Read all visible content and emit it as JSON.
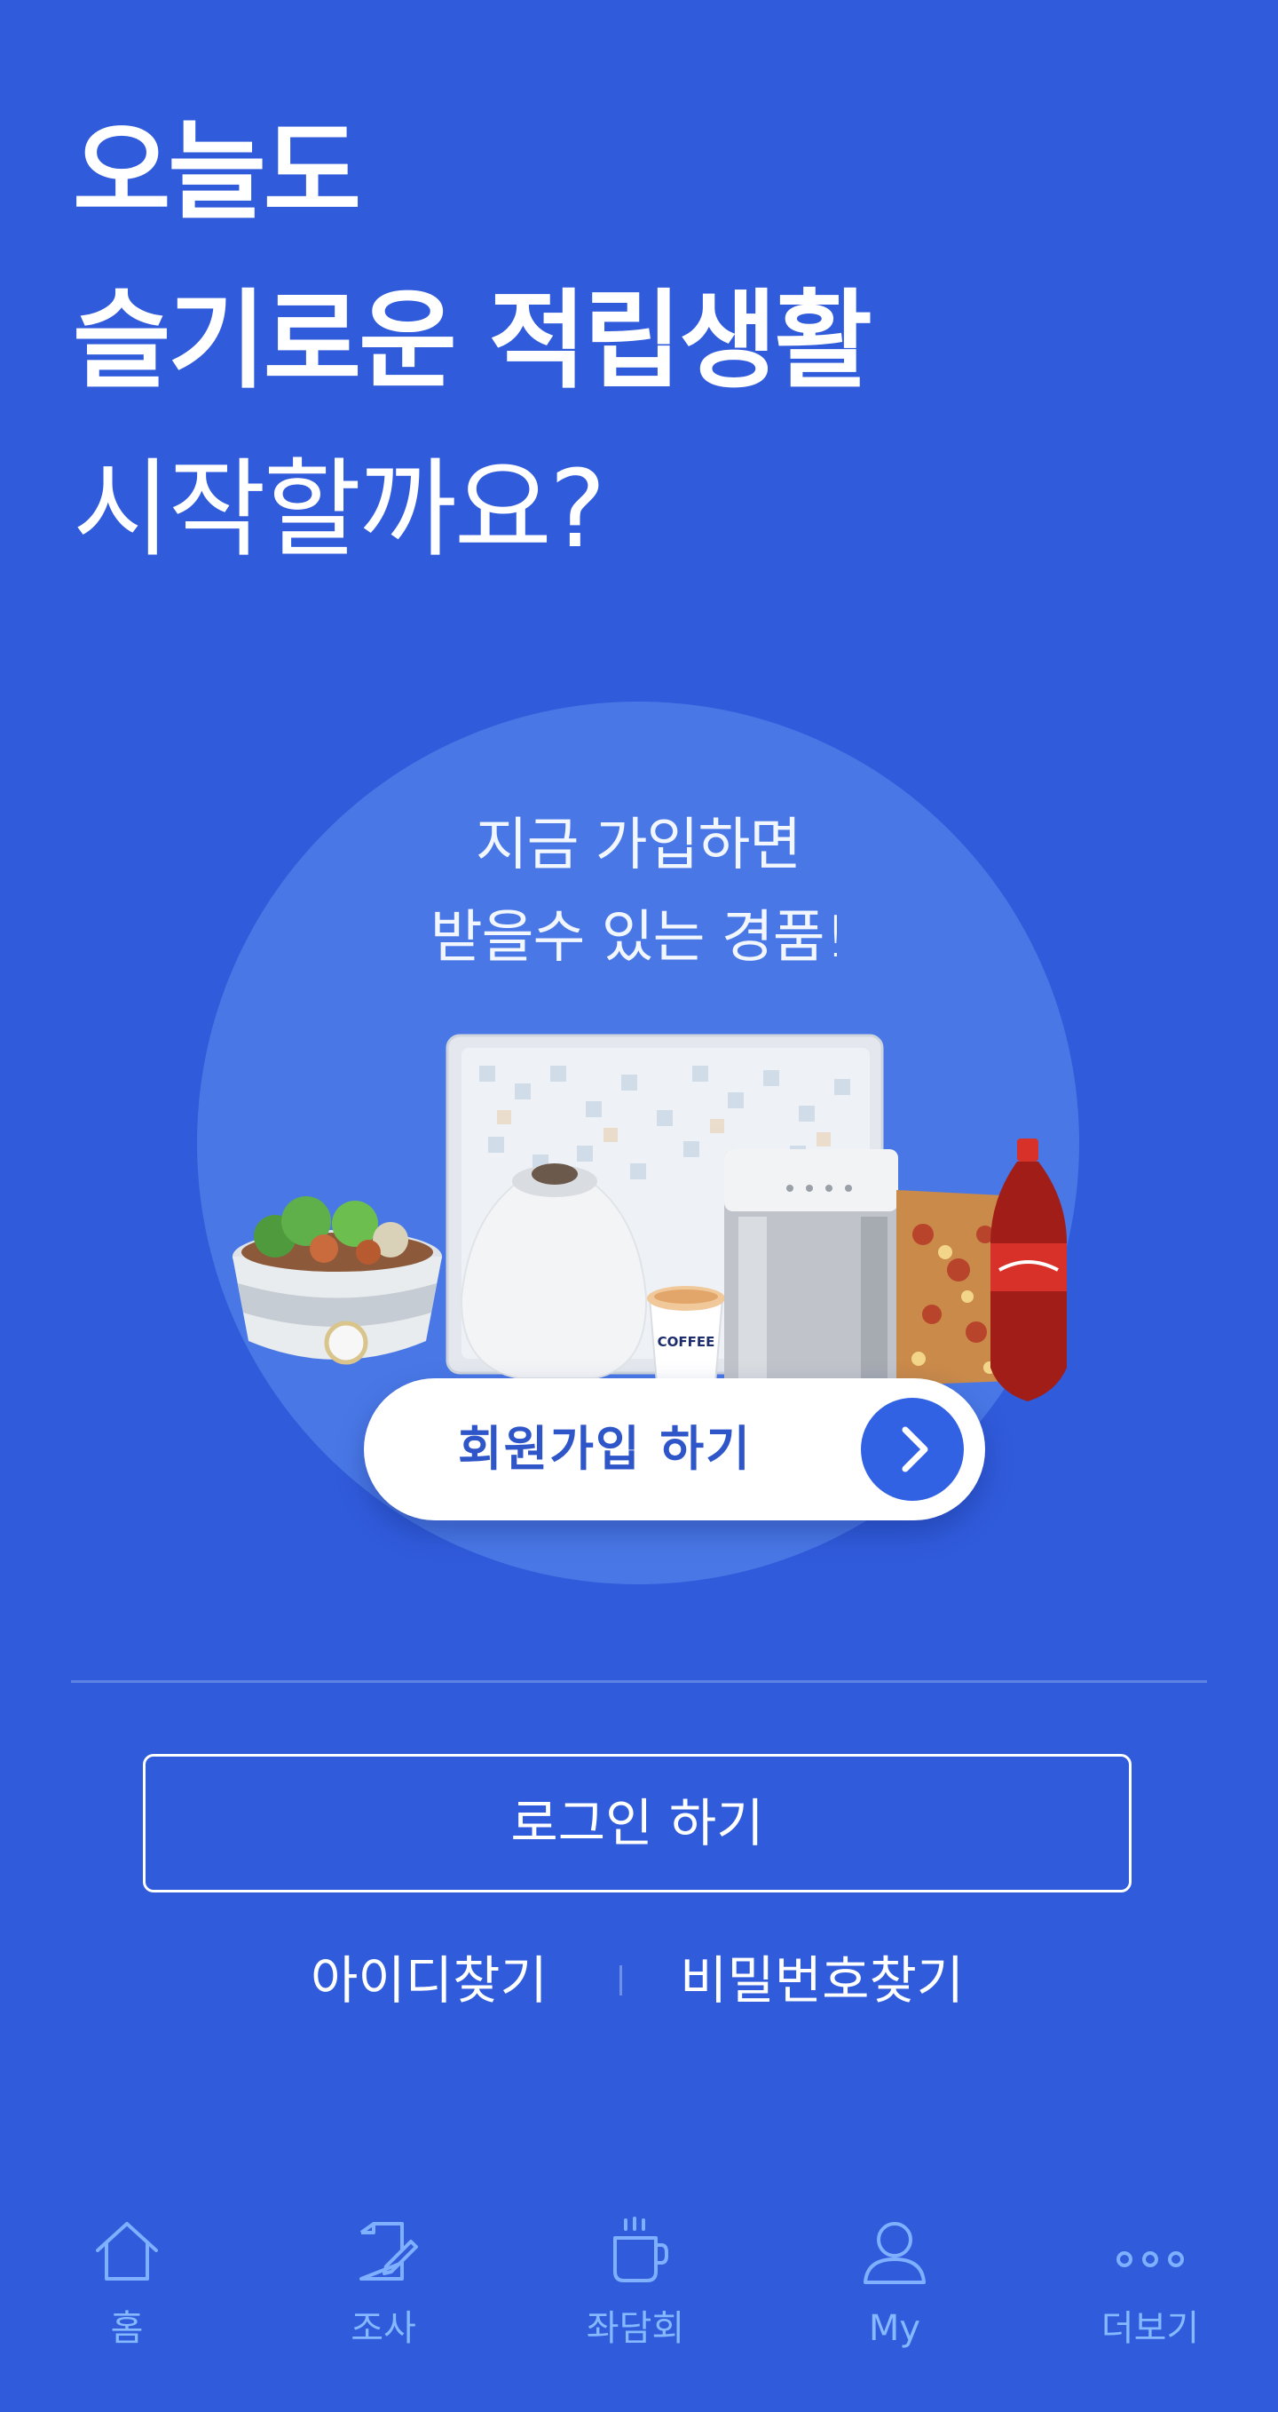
{
  "headline": {
    "line1": "오늘도",
    "line2": "슬기로운 적립생활",
    "line3": "시작할까요?"
  },
  "promo": {
    "line1": "지금 가입하면",
    "line2": "받을수 있는 경품!",
    "coffee_cup_text": "COFFEE"
  },
  "signup": {
    "label": "회원가입 하기",
    "icon": "chevron-right-icon"
  },
  "login": {
    "label": "로그인 하기"
  },
  "find": {
    "id_label": "아이디찾기",
    "pw_label": "비밀번호찾기"
  },
  "nav": {
    "items": [
      {
        "label": "홈",
        "icon": "home-icon"
      },
      {
        "label": "조사",
        "icon": "survey-icon"
      },
      {
        "label": "좌담회",
        "icon": "coffee-cup-icon"
      },
      {
        "label": "My",
        "icon": "person-icon"
      },
      {
        "label": "더보기",
        "icon": "more-icon"
      }
    ]
  },
  "colors": {
    "background": "#305bdb",
    "circle": "#4978e6",
    "accent": "#3162e3",
    "nav_icon": "#7fb0ff"
  }
}
